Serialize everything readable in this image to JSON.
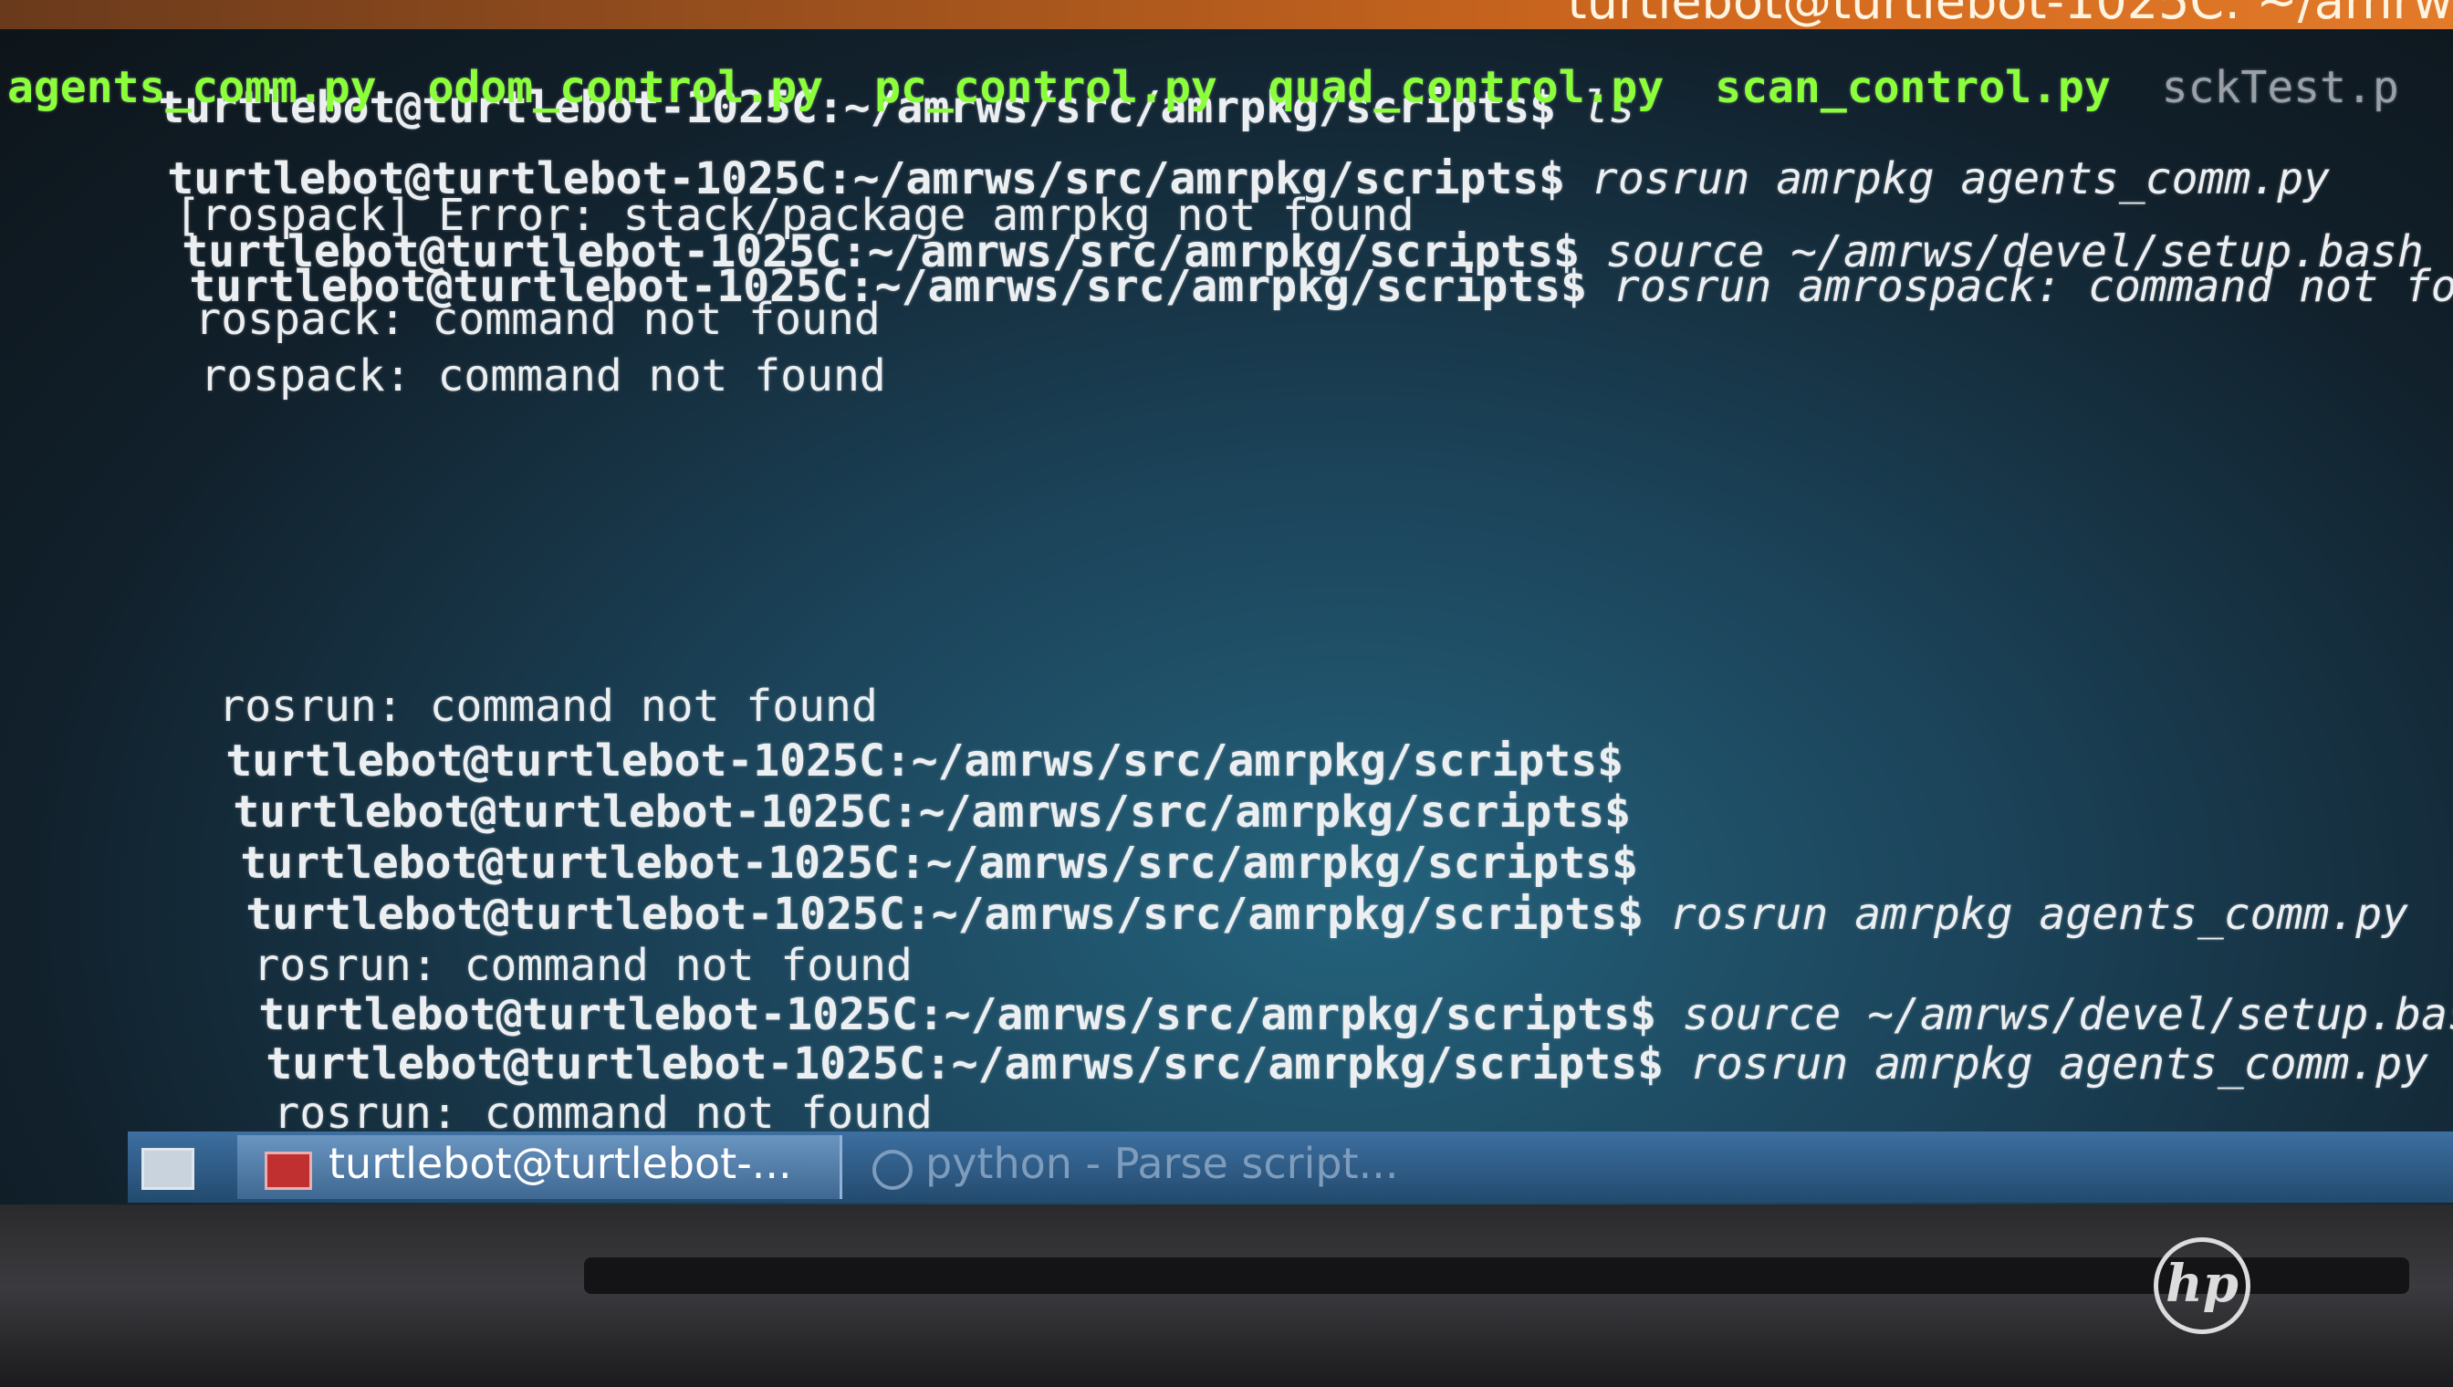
{
  "window": {
    "title": "turtlebot@turtlebot-1025C: ~/amrw"
  },
  "terminal": {
    "prompt": "turtlebot@turtlebot-1025C:~/amrws/src/amrpkg/scripts$",
    "lines": [
      {
        "cmd": " ls"
      },
      {
        "files": [
          "agents_comm.py",
          "odom_control.py",
          "pc_control.py",
          "quad_control.py",
          "scan_control.py",
          "sckTest.p"
        ]
      },
      {
        "cmd": " rosrun amrpkg agents_comm.py"
      },
      {
        "out": "[rospack] Error: stack/package amrpkg not found"
      },
      {
        "cmd": " source ~/amrws/devel/setup.bash"
      },
      {
        "cmd": " rosrun amrospack: command not found"
      },
      {
        "out": "rospack: command not found"
      },
      {
        "out": "rospack: command not found"
      },
      {
        "out": "rosrun: command not found"
      },
      {
        "cmd": ""
      },
      {
        "cmd": ""
      },
      {
        "cmd": ""
      },
      {
        "cmd": " rosrun amrpkg agents_comm.py"
      },
      {
        "out": "rosrun: command not found"
      },
      {
        "cmd": " source ~/amrws/devel/setup.bash"
      },
      {
        "cmd": " rosrun amrpkg agents_comm.py"
      },
      {
        "out": "rosrun: command not found"
      },
      {
        "cmd": ""
      }
    ]
  },
  "taskbar": {
    "active_window": "turtlebot@turtlebot-...",
    "other_window": "python - Parse script..."
  },
  "bezel": {
    "logo": "hp"
  },
  "colors": {
    "file_green": "#8aff3a",
    "titlebar": "#d2691e",
    "taskbar": "#3d6fa0"
  }
}
